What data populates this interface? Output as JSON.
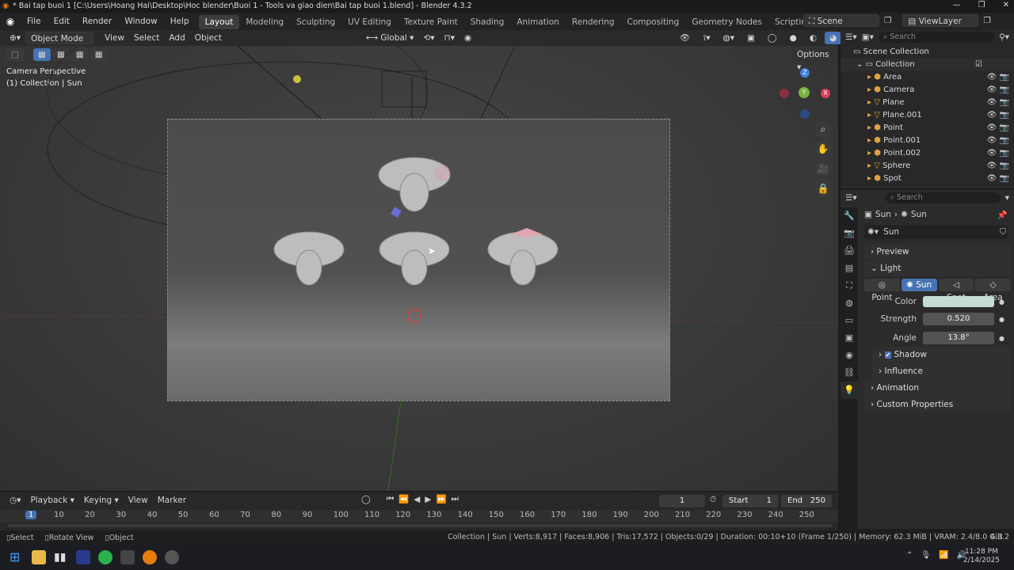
{
  "window": {
    "title": "* Bai tap buoi 1 [C:\\Users\\Hoang Hai\\Desktop\\Hoc blender\\Buoi 1 - Tools va giao dien\\Bai tap buoi 1.blend] - Blender 4.3.2"
  },
  "menubar": {
    "menus": [
      "File",
      "Edit",
      "Render",
      "Window",
      "Help"
    ],
    "workspaces": [
      "Layout",
      "Modeling",
      "Sculpting",
      "UV Editing",
      "Texture Paint",
      "Shading",
      "Animation",
      "Rendering",
      "Compositing",
      "Geometry Nodes",
      "Scripting"
    ],
    "active_workspace": "Layout",
    "scene": "Scene",
    "view_layer": "ViewLayer"
  },
  "viewport_header": {
    "mode": "Object Mode",
    "menus": [
      "View",
      "Select",
      "Add",
      "Object"
    ],
    "transform": "Global",
    "options": "Options"
  },
  "viewport": {
    "perspective": "Camera Perspective",
    "collection_info": "(1) Collection | Sun"
  },
  "outliner": {
    "search_placeholder": "Search",
    "scene_collection": "Scene Collection",
    "collection": "Collection",
    "items": [
      {
        "name": "Area",
        "type": "light"
      },
      {
        "name": "Camera",
        "type": "camera"
      },
      {
        "name": "Plane",
        "type": "mesh"
      },
      {
        "name": "Plane.001",
        "type": "mesh"
      },
      {
        "name": "Point",
        "type": "light"
      },
      {
        "name": "Point.001",
        "type": "light"
      },
      {
        "name": "Point.002",
        "type": "light"
      },
      {
        "name": "Sphere",
        "type": "mesh"
      },
      {
        "name": "Spot",
        "type": "light"
      }
    ]
  },
  "properties": {
    "search_placeholder": "Search",
    "breadcrumb": [
      "Sun",
      "Sun"
    ],
    "datablock": "Sun",
    "panels": {
      "preview": "Preview",
      "light": "Light",
      "animation": "Animation",
      "custom_properties": "Custom Properties"
    },
    "light_types": [
      "Point",
      "Sun",
      "Spot",
      "Area"
    ],
    "active_light_type": "Sun",
    "color_label": "Color",
    "color_value": "#c4dcd4",
    "strength_label": "Strength",
    "strength": "0.520",
    "angle_label": "Angle",
    "angle": "13.8°",
    "shadow_label": "Shadow",
    "shadow_checked": true,
    "influence_label": "Influence"
  },
  "timeline": {
    "menus": [
      "Playback",
      "Keying",
      "View",
      "Marker"
    ],
    "current_frame": "1",
    "start_label": "Start",
    "start": "1",
    "end_label": "End",
    "end": "250",
    "ticks": [
      "1",
      "10",
      "20",
      "30",
      "40",
      "50",
      "60",
      "70",
      "80",
      "90",
      "100",
      "110",
      "120",
      "130",
      "140",
      "150",
      "160",
      "170",
      "180",
      "190",
      "200",
      "210",
      "220",
      "230",
      "240",
      "250"
    ]
  },
  "statusbar": {
    "hints": [
      "Select",
      "Rotate View",
      "Object"
    ],
    "stats": "Collection | Sun | Verts:8,917 | Faces:8,906 | Tris:17,572 | Objects:0/29 | Duration: 00:10+10 (Frame 1/250) | Memory: 62.3 MiB | VRAM: 2.4/8.0 GiB",
    "version": "4.3.2"
  },
  "taskbar": {
    "time": "11:28 PM",
    "date": "2/14/2025"
  }
}
